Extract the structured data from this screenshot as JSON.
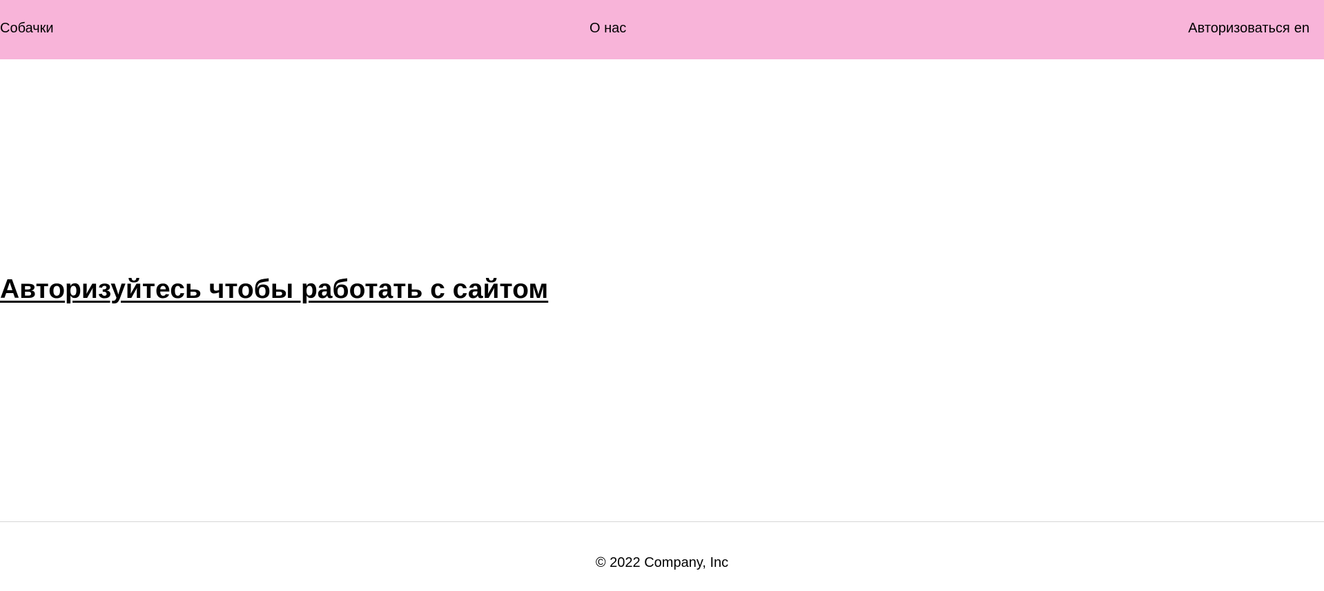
{
  "header": {
    "background_color": "#f8b4d9",
    "brand_label": "Собачки",
    "about_label": "О нас",
    "login_label": "Авторизоваться",
    "language_label": "en"
  },
  "main": {
    "prompt_text": "Авторизуйтесь чтобы работать с сайтом"
  },
  "footer": {
    "copyright": "© 2022 Company, Inc"
  }
}
